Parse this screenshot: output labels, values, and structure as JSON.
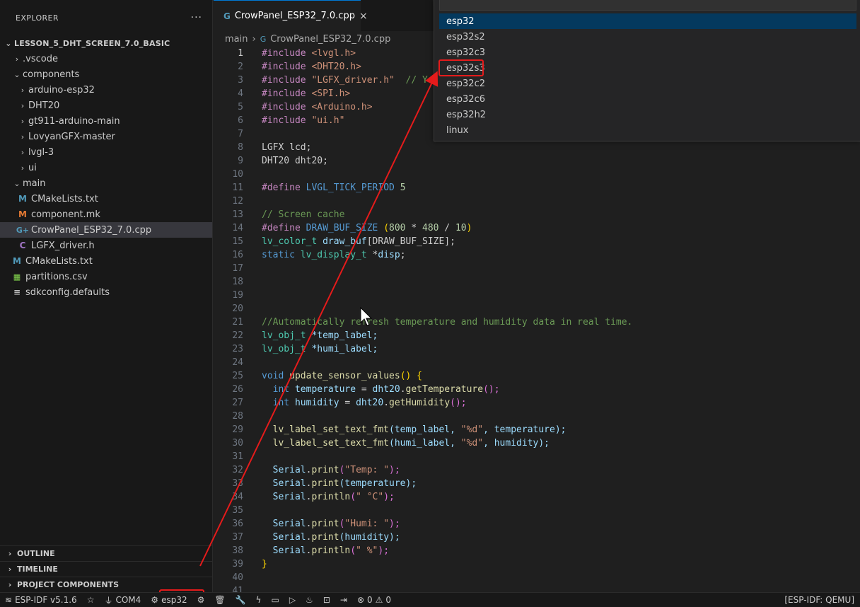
{
  "sidebar": {
    "title": "EXPLORER",
    "more": "···",
    "root": "LESSON_5_DHT_SCREEN_7.0_BASIC",
    "items": [
      {
        "label": ".vscode"
      },
      {
        "label": "components"
      },
      {
        "label": "arduino-esp32"
      },
      {
        "label": "DHT20"
      },
      {
        "label": "gt911-arduino-main"
      },
      {
        "label": "LovyanGFX-master"
      },
      {
        "label": "lvgl-3"
      },
      {
        "label": "ui"
      },
      {
        "label": "main"
      },
      {
        "label": "CMakeLists.txt"
      },
      {
        "label": "component.mk"
      },
      {
        "label": "CrowPanel_ESP32_7.0.cpp"
      },
      {
        "label": "LGFX_driver.h"
      },
      {
        "label": "CMakeLists.txt"
      },
      {
        "label": "partitions.csv"
      },
      {
        "label": "sdkconfig.defaults"
      }
    ],
    "sections": [
      "OUTLINE",
      "TIMELINE",
      "PROJECT COMPONENTS"
    ]
  },
  "editor": {
    "tab_label": "CrowPanel_ESP32_7.0.cpp",
    "breadcrumb": [
      "main",
      "CrowPanel_ESP32_7.0.cpp"
    ],
    "line_numbers": [
      "1",
      "2",
      "3",
      "4",
      "5",
      "6",
      "7",
      "8",
      "9",
      "10",
      "11",
      "12",
      "13",
      "14",
      "15",
      "16",
      "17",
      "18",
      "19",
      "20",
      "21",
      "22",
      "23",
      "24",
      "25",
      "26",
      "27",
      "28",
      "29",
      "30",
      "31",
      "32",
      "33",
      "34",
      "35",
      "36",
      "37",
      "38",
      "39",
      "40",
      "41"
    ],
    "code": {
      "l1a": "#include ",
      "l1b": "<lvgl.h>",
      "l2a": "#include ",
      "l2b": "<DHT20.h>",
      "l3a": "#include ",
      "l3b": "\"LGFX_driver.h\"",
      "l3c": "  // You",
      "l4a": "#include ",
      "l4b": "<SPI.h>",
      "l5a": "#include ",
      "l5b": "<Arduino.h>",
      "l6a": "#include ",
      "l6b": "\"ui.h\"",
      "l8": "LGFX lcd;",
      "l9": "DHT20 dht20;",
      "l11a": "#define ",
      "l11b": "LVGL_TICK_PERIOD ",
      "l11c": "5",
      "l13": "// Screen cache",
      "l14a": "#define ",
      "l14b": "DRAW_BUF_SIZE ",
      "l14c": "(",
      "l14d": "800",
      "l14e": " * ",
      "l14f": "480",
      "l14g": " / ",
      "l14h": "10",
      "l14i": ")",
      "l15a": "lv_color_t ",
      "l15b": "draw_buf",
      "l15c": "[DRAW_BUF_SIZE];",
      "l16a": "static ",
      "l16b": "lv_display_t ",
      "l16c": "*",
      "l16d": "disp",
      "l16e": ";",
      "l21": "//Automatically refresh temperature and humidity data in real time.",
      "l22a": "lv_obj_t ",
      "l22b": "*temp_label;",
      "l23a": "lv_obj_t ",
      "l23b": "*humi_label;",
      "l25a": "void ",
      "l25b": "update_sensor_values",
      "l25c": "() {",
      "l26a": "  int ",
      "l26b": "temperature",
      "l26c": " = ",
      "l26d": "dht20",
      "l26e": ".",
      "l26f": "getTemperature",
      "l26g": "();",
      "l27a": "  int ",
      "l27b": "humidity",
      "l27c": " = ",
      "l27d": "dht20",
      "l27e": ".",
      "l27f": "getHumidity",
      "l27g": "();",
      "l29a": "  lv_label_set_text_fmt",
      "l29b": "(temp_label, ",
      "l29c": "\"%d\"",
      "l29d": ", temperature);",
      "l30a": "  lv_label_set_text_fmt",
      "l30b": "(humi_label, ",
      "l30c": "\"%d\"",
      "l30d": ", humidity);",
      "l32a": "  Serial",
      "l32b": ".",
      "l32c": "print",
      "l32d": "(",
      "l32e": "\"Temp: \"",
      "l32f": ");",
      "l33a": "  Serial",
      "l33b": ".",
      "l33c": "print",
      "l33d": "(temperature);",
      "l34a": "  Serial",
      "l34b": ".",
      "l34c": "println",
      "l34d": "(",
      "l34e": "\" °C\"",
      "l34f": ");",
      "l36a": "  Serial",
      "l36b": ".",
      "l36c": "print",
      "l36d": "(",
      "l36e": "\"Humi: \"",
      "l36f": ");",
      "l37a": "  Serial",
      "l37b": ".",
      "l37c": "print",
      "l37d": "(humidity);",
      "l38a": "  Serial",
      "l38b": ".",
      "l38c": "println",
      "l38d": "(",
      "l38e": "\" %\"",
      "l38f": ");",
      "l39": "}"
    }
  },
  "dropdown": {
    "options": [
      "esp32",
      "esp32s2",
      "esp32c3",
      "esp32s3",
      "esp32c2",
      "esp32c6",
      "esp32h2",
      "linux"
    ],
    "highlighted": "esp32",
    "annotated": "esp32s3"
  },
  "statusbar": {
    "idf_version": "ESP-IDF v5.1.6",
    "port": "COM4",
    "target": "esp32",
    "errors": "0",
    "warnings": "0",
    "right_label": "[ESP-IDF: QEMU]"
  },
  "colors": {
    "annotation_red": "#e51b1b",
    "accent_blue": "#0078d4"
  }
}
